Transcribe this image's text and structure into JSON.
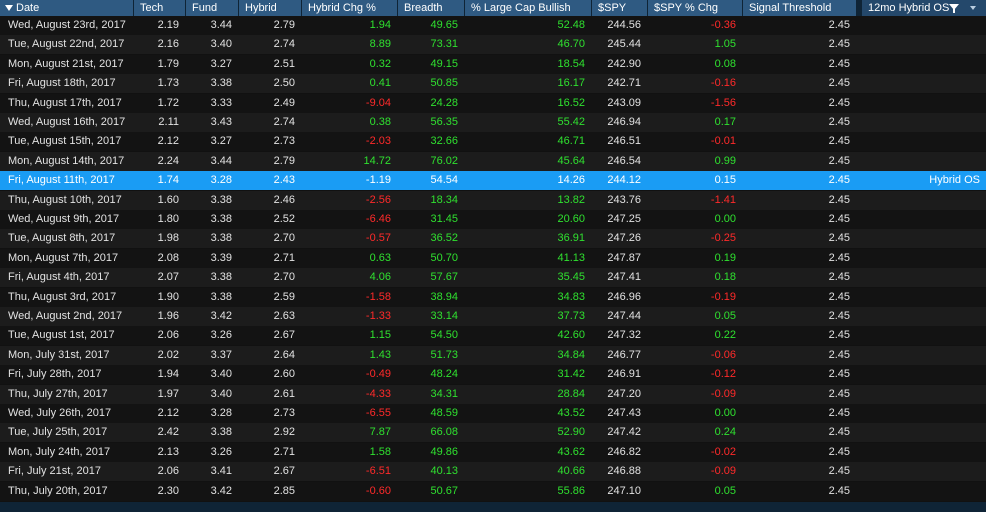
{
  "columns": [
    {
      "key": "date",
      "label": "Date"
    },
    {
      "key": "tech",
      "label": "Tech"
    },
    {
      "key": "fund",
      "label": "Fund"
    },
    {
      "key": "hybrid",
      "label": "Hybrid"
    },
    {
      "key": "hybrid_chg",
      "label": "Hybrid Chg %"
    },
    {
      "key": "breadth",
      "label": "Breadth"
    },
    {
      "key": "large_cap_bullish",
      "label": "% Large Cap Bullish"
    },
    {
      "key": "spy",
      "label": "$SPY"
    },
    {
      "key": "spy_chg",
      "label": "$SPY % Chg"
    },
    {
      "key": "signal_threshold",
      "label": "Signal Threshold"
    },
    {
      "key": "hybrid_os",
      "label": "12mo Hybrid OS"
    }
  ],
  "icons": {
    "sort": "sort-desc-icon",
    "filter": "filter-icon",
    "column_menu": "chevron-down-icon"
  },
  "colors": {
    "header_bg": "#2f5a82",
    "selected_row": "#1a9cf4",
    "positive": "#2fe02f",
    "negative": "#ff2a2a"
  },
  "selected_row_index": 8,
  "rows": [
    {
      "date": "Wed, August 23rd, 2017",
      "tech": "2.19",
      "fund": "3.44",
      "hybrid": "2.79",
      "hybrid_chg": "1.94",
      "breadth": "49.65",
      "large_cap_bullish": "52.48",
      "spy": "244.56",
      "spy_chg": "-0.36",
      "signal_threshold": "2.45",
      "hybrid_os": ""
    },
    {
      "date": "Tue, August 22nd, 2017",
      "tech": "2.16",
      "fund": "3.40",
      "hybrid": "2.74",
      "hybrid_chg": "8.89",
      "breadth": "73.31",
      "large_cap_bullish": "46.70",
      "spy": "245.44",
      "spy_chg": "1.05",
      "signal_threshold": "2.45",
      "hybrid_os": ""
    },
    {
      "date": "Mon, August 21st, 2017",
      "tech": "1.79",
      "fund": "3.27",
      "hybrid": "2.51",
      "hybrid_chg": "0.32",
      "breadth": "49.15",
      "large_cap_bullish": "18.54",
      "spy": "242.90",
      "spy_chg": "0.08",
      "signal_threshold": "2.45",
      "hybrid_os": ""
    },
    {
      "date": "Fri, August 18th, 2017",
      "tech": "1.73",
      "fund": "3.38",
      "hybrid": "2.50",
      "hybrid_chg": "0.41",
      "breadth": "50.85",
      "large_cap_bullish": "16.17",
      "spy": "242.71",
      "spy_chg": "-0.16",
      "signal_threshold": "2.45",
      "hybrid_os": ""
    },
    {
      "date": "Thu, August 17th, 2017",
      "tech": "1.72",
      "fund": "3.33",
      "hybrid": "2.49",
      "hybrid_chg": "-9.04",
      "breadth": "24.28",
      "large_cap_bullish": "16.52",
      "spy": "243.09",
      "spy_chg": "-1.56",
      "signal_threshold": "2.45",
      "hybrid_os": ""
    },
    {
      "date": "Wed, August 16th, 2017",
      "tech": "2.11",
      "fund": "3.43",
      "hybrid": "2.74",
      "hybrid_chg": "0.38",
      "breadth": "56.35",
      "large_cap_bullish": "55.42",
      "spy": "246.94",
      "spy_chg": "0.17",
      "signal_threshold": "2.45",
      "hybrid_os": ""
    },
    {
      "date": "Tue, August 15th, 2017",
      "tech": "2.12",
      "fund": "3.27",
      "hybrid": "2.73",
      "hybrid_chg": "-2.03",
      "breadth": "32.66",
      "large_cap_bullish": "46.71",
      "spy": "246.51",
      "spy_chg": "-0.01",
      "signal_threshold": "2.45",
      "hybrid_os": ""
    },
    {
      "date": "Mon, August 14th, 2017",
      "tech": "2.24",
      "fund": "3.44",
      "hybrid": "2.79",
      "hybrid_chg": "14.72",
      "breadth": "76.02",
      "large_cap_bullish": "45.64",
      "spy": "246.54",
      "spy_chg": "0.99",
      "signal_threshold": "2.45",
      "hybrid_os": ""
    },
    {
      "date": "Fri, August 11th, 2017",
      "tech": "1.74",
      "fund": "3.28",
      "hybrid": "2.43",
      "hybrid_chg": "-1.19",
      "breadth": "54.54",
      "large_cap_bullish": "14.26",
      "spy": "244.12",
      "spy_chg": "0.15",
      "signal_threshold": "2.45",
      "hybrid_os": "Hybrid OS"
    },
    {
      "date": "Thu, August 10th, 2017",
      "tech": "1.60",
      "fund": "3.38",
      "hybrid": "2.46",
      "hybrid_chg": "-2.56",
      "breadth": "18.34",
      "large_cap_bullish": "13.82",
      "spy": "243.76",
      "spy_chg": "-1.41",
      "signal_threshold": "2.45",
      "hybrid_os": ""
    },
    {
      "date": "Wed, August 9th, 2017",
      "tech": "1.80",
      "fund": "3.38",
      "hybrid": "2.52",
      "hybrid_chg": "-6.46",
      "breadth": "31.45",
      "large_cap_bullish": "20.60",
      "spy": "247.25",
      "spy_chg": "0.00",
      "signal_threshold": "2.45",
      "hybrid_os": ""
    },
    {
      "date": "Tue, August 8th, 2017",
      "tech": "1.98",
      "fund": "3.38",
      "hybrid": "2.70",
      "hybrid_chg": "-0.57",
      "breadth": "36.52",
      "large_cap_bullish": "36.91",
      "spy": "247.26",
      "spy_chg": "-0.25",
      "signal_threshold": "2.45",
      "hybrid_os": ""
    },
    {
      "date": "Mon, August 7th, 2017",
      "tech": "2.08",
      "fund": "3.39",
      "hybrid": "2.71",
      "hybrid_chg": "0.63",
      "breadth": "50.70",
      "large_cap_bullish": "41.13",
      "spy": "247.87",
      "spy_chg": "0.19",
      "signal_threshold": "2.45",
      "hybrid_os": ""
    },
    {
      "date": "Fri, August 4th, 2017",
      "tech": "2.07",
      "fund": "3.38",
      "hybrid": "2.70",
      "hybrid_chg": "4.06",
      "breadth": "57.67",
      "large_cap_bullish": "35.45",
      "spy": "247.41",
      "spy_chg": "0.18",
      "signal_threshold": "2.45",
      "hybrid_os": ""
    },
    {
      "date": "Thu, August 3rd, 2017",
      "tech": "1.90",
      "fund": "3.38",
      "hybrid": "2.59",
      "hybrid_chg": "-1.58",
      "breadth": "38.94",
      "large_cap_bullish": "34.83",
      "spy": "246.96",
      "spy_chg": "-0.19",
      "signal_threshold": "2.45",
      "hybrid_os": ""
    },
    {
      "date": "Wed, August 2nd, 2017",
      "tech": "1.96",
      "fund": "3.42",
      "hybrid": "2.63",
      "hybrid_chg": "-1.33",
      "breadth": "33.14",
      "large_cap_bullish": "37.73",
      "spy": "247.44",
      "spy_chg": "0.05",
      "signal_threshold": "2.45",
      "hybrid_os": ""
    },
    {
      "date": "Tue, August 1st, 2017",
      "tech": "2.06",
      "fund": "3.26",
      "hybrid": "2.67",
      "hybrid_chg": "1.15",
      "breadth": "54.50",
      "large_cap_bullish": "42.60",
      "spy": "247.32",
      "spy_chg": "0.22",
      "signal_threshold": "2.45",
      "hybrid_os": ""
    },
    {
      "date": "Mon, July 31st, 2017",
      "tech": "2.02",
      "fund": "3.37",
      "hybrid": "2.64",
      "hybrid_chg": "1.43",
      "breadth": "51.73",
      "large_cap_bullish": "34.84",
      "spy": "246.77",
      "spy_chg": "-0.06",
      "signal_threshold": "2.45",
      "hybrid_os": ""
    },
    {
      "date": "Fri, July 28th, 2017",
      "tech": "1.94",
      "fund": "3.40",
      "hybrid": "2.60",
      "hybrid_chg": "-0.49",
      "breadth": "48.24",
      "large_cap_bullish": "31.42",
      "spy": "246.91",
      "spy_chg": "-0.12",
      "signal_threshold": "2.45",
      "hybrid_os": ""
    },
    {
      "date": "Thu, July 27th, 2017",
      "tech": "1.97",
      "fund": "3.40",
      "hybrid": "2.61",
      "hybrid_chg": "-4.33",
      "breadth": "34.31",
      "large_cap_bullish": "28.84",
      "spy": "247.20",
      "spy_chg": "-0.09",
      "signal_threshold": "2.45",
      "hybrid_os": ""
    },
    {
      "date": "Wed, July 26th, 2017",
      "tech": "2.12",
      "fund": "3.28",
      "hybrid": "2.73",
      "hybrid_chg": "-6.55",
      "breadth": "48.59",
      "large_cap_bullish": "43.52",
      "spy": "247.43",
      "spy_chg": "0.00",
      "signal_threshold": "2.45",
      "hybrid_os": ""
    },
    {
      "date": "Tue, July 25th, 2017",
      "tech": "2.42",
      "fund": "3.38",
      "hybrid": "2.92",
      "hybrid_chg": "7.87",
      "breadth": "66.08",
      "large_cap_bullish": "52.90",
      "spy": "247.42",
      "spy_chg": "0.24",
      "signal_threshold": "2.45",
      "hybrid_os": ""
    },
    {
      "date": "Mon, July 24th, 2017",
      "tech": "2.13",
      "fund": "3.26",
      "hybrid": "2.71",
      "hybrid_chg": "1.58",
      "breadth": "49.86",
      "large_cap_bullish": "43.62",
      "spy": "246.82",
      "spy_chg": "-0.02",
      "signal_threshold": "2.45",
      "hybrid_os": ""
    },
    {
      "date": "Fri, July 21st, 2017",
      "tech": "2.06",
      "fund": "3.41",
      "hybrid": "2.67",
      "hybrid_chg": "-6.51",
      "breadth": "40.13",
      "large_cap_bullish": "40.66",
      "spy": "246.88",
      "spy_chg": "-0.09",
      "signal_threshold": "2.45",
      "hybrid_os": ""
    },
    {
      "date": "Thu, July 20th, 2017",
      "tech": "2.30",
      "fund": "3.42",
      "hybrid": "2.85",
      "hybrid_chg": "-0.60",
      "breadth": "50.67",
      "large_cap_bullish": "55.86",
      "spy": "247.10",
      "spy_chg": "0.05",
      "signal_threshold": "2.45",
      "hybrid_os": ""
    }
  ]
}
